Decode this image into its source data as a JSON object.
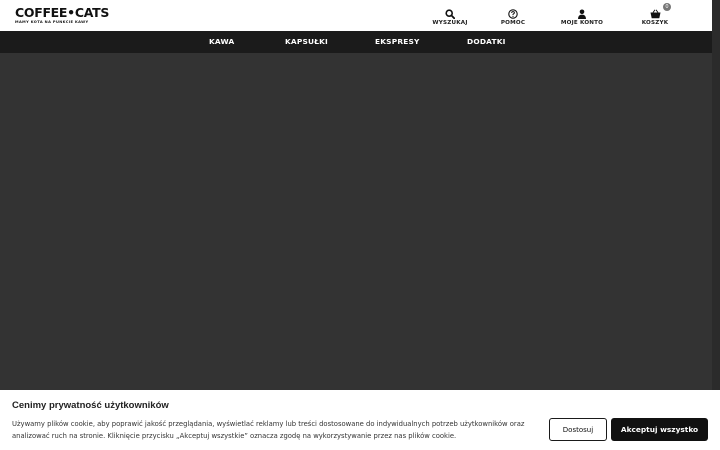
{
  "logo": {
    "text": "COFFEE•CATS",
    "tagline": "MAMY KOTA NA PUNKCIE KAWY"
  },
  "header": {
    "search_label": "WYSZUKAJ",
    "help_label": "POMOC",
    "account_label": "MOJE KONTO",
    "cart_label": "KOSZYK",
    "cart_count": "0",
    "icons": [
      "search-icon",
      "help-icon",
      "user-icon",
      "basket-icon"
    ]
  },
  "nav": {
    "items": [
      {
        "label": "KAWA"
      },
      {
        "label": "KAPSUŁKI"
      },
      {
        "label": "EKSPRESY"
      },
      {
        "label": "DODATKI"
      }
    ]
  },
  "cookie": {
    "title": "Cenimy prywatność użytkowników",
    "text": "Używamy plików cookie, aby poprawić jakość przeglądania, wyświetlać reklamy lub treści dostosowane do indywidualnych potrzeb użytkowników oraz analizować ruch na stronie. Kliknięcie przycisku „Akceptuj wszystkie” oznacza zgodę na wykorzystywanie przez nas plików cookie.",
    "customize_label": "Dostosuj",
    "accept_label": "Akceptuj wszystko"
  },
  "colors": {
    "header_bg": "#ffffff",
    "nav_bg": "#1b1b1b",
    "overlay_bg": "#333333",
    "button_dark": "#111111"
  }
}
